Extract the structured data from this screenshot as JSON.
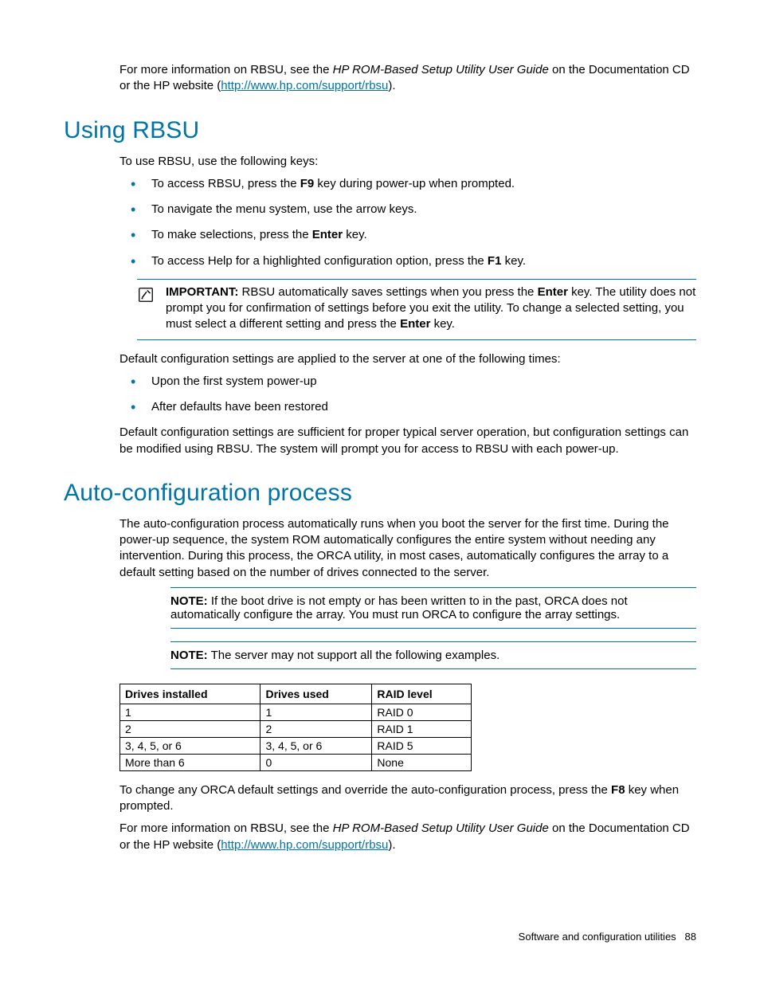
{
  "intro": {
    "p1_a": "For more information on RBSU, see the ",
    "p1_i": "HP ROM-Based Setup Utility User Guide",
    "p1_b": " on the Documentation CD or the HP website (",
    "link": "http://www.hp.com/support/rbsu",
    "p1_c": ")."
  },
  "section1": {
    "heading": "Using RBSU",
    "lead": "To use RBSU, use the following keys:",
    "bullets": [
      {
        "a": "To access RBSU, press the ",
        "b": "F9",
        "c": " key during power-up when prompted."
      },
      {
        "a": "To navigate the menu system, use the arrow keys.",
        "b": "",
        "c": ""
      },
      {
        "a": "To make selections, press the ",
        "b": "Enter",
        "c": " key."
      },
      {
        "a": "To access Help for a highlighted configuration option, press the ",
        "b": "F1",
        "c": " key."
      }
    ],
    "important": {
      "label": "IMPORTANT:",
      "t1": "  RBSU automatically saves settings when you press the ",
      "b1": "Enter",
      "t2": " key. The utility does not prompt you for confirmation of settings before you exit the utility. To change a selected setting, you must select a different setting and press the ",
      "b2": "Enter",
      "t3": " key."
    },
    "p2": "Default configuration settings are applied to the server at one of the following times:",
    "bullets2": [
      "Upon the first system power-up",
      "After defaults have been restored"
    ],
    "p3": "Default configuration settings are sufficient for proper typical server operation, but configuration settings can be modified using RBSU. The system will prompt you for access to RBSU with each power-up."
  },
  "section2": {
    "heading": "Auto-configuration process",
    "p1": "The auto-configuration process automatically runs when you boot the server for the first time. During the power-up sequence, the system ROM automatically configures the entire system without needing any intervention. During this process, the ORCA utility, in most cases, automatically configures the array to a default setting based on the number of drives connected to the server.",
    "note1": {
      "label": "NOTE:",
      "text": "  If the boot drive is not empty or has been written to in the past, ORCA does not automatically configure the array. You must run ORCA to configure the array settings."
    },
    "note2": {
      "label": "NOTE:",
      "text": "  The server may not support all the following examples."
    },
    "table": {
      "headers": [
        "Drives installed",
        "Drives used",
        "RAID level"
      ],
      "rows": [
        [
          "1",
          "1",
          "RAID 0"
        ],
        [
          "2",
          "2",
          "RAID 1"
        ],
        [
          "3, 4, 5, or 6",
          "3, 4, 5, or 6",
          "RAID 5"
        ],
        [
          "More than 6",
          "0",
          "None"
        ]
      ]
    },
    "p2_a": "To change any ORCA default settings and override the auto-configuration process, press the ",
    "p2_b": "F8",
    "p2_c": " key when prompted.",
    "p3_a": "For more information on RBSU, see the ",
    "p3_i": "HP ROM-Based Setup Utility User Guide",
    "p3_b": " on the Documentation CD or the HP website (",
    "link": "http://www.hp.com/support/rbsu",
    "p3_c": ")."
  },
  "footer": {
    "text": "Software and configuration utilities",
    "page": "88"
  }
}
